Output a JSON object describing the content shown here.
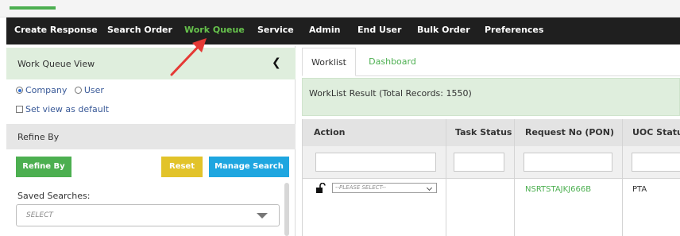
{
  "nav": {
    "items": [
      {
        "label": "Create Response"
      },
      {
        "label": "Search Order"
      },
      {
        "label": "Work Queue",
        "active": true
      },
      {
        "label": "Service"
      },
      {
        "label": "Admin"
      },
      {
        "label": "End User"
      },
      {
        "label": "Bulk Order"
      },
      {
        "label": "Preferences"
      }
    ]
  },
  "left_panel": {
    "title": "Work Queue View",
    "collapse_icon": "chevron-left-icon",
    "view_options": [
      {
        "label": "Company",
        "selected": true
      },
      {
        "label": "User",
        "selected": false
      }
    ],
    "set_default_label": "Set view as default",
    "set_default_checked": false,
    "refine_title": "Refine By",
    "buttons": {
      "refine": "Refine By",
      "reset": "Reset",
      "manage": "Manage Search"
    },
    "saved_searches_label": "Saved Searches:",
    "saved_searches_value": "SELECT"
  },
  "right_panel": {
    "tabs": [
      {
        "label": "Worklist",
        "active": true
      },
      {
        "label": "Dashboard",
        "active": false
      }
    ],
    "result_text": "WorkList Result (Total Records: 1550)",
    "table": {
      "columns": [
        "Action",
        "Task Status",
        "Request No (PON)",
        "UOC Status"
      ],
      "rows": [
        {
          "action_icon": "lock-icon",
          "action_select": "--PLEASE SELECT--",
          "task_status": "",
          "pon": "NSRTSTAJKJ666B",
          "uoc_status": "PTA"
        }
      ]
    }
  },
  "colors": {
    "nav_bg": "#1f1f1f",
    "accent_green": "#4caf50",
    "reset_yellow": "#e2c32a",
    "manage_blue": "#1ea6e0",
    "annotation_red": "#e53935"
  }
}
